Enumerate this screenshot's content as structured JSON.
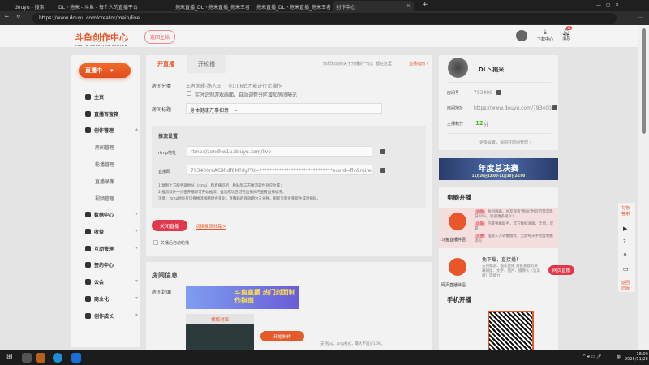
{
  "browser": {
    "tabs": [
      "douyu - 搜索",
      "DL丶拖米 - 斗鱼 - 每个人的直播平台",
      "拖米直播_DL丶拖米直播_拖米王者",
      "拖米直播_DL丶拖米直播_拖米王者",
      "创作中心"
    ],
    "url": "https://www.douyu.com/creator/main/live"
  },
  "header": {
    "logo": "斗鱼创作中心",
    "logo_sub": "DOUYU CREATION CENTER",
    "back_label": "返回主站",
    "download": "下载中心",
    "messages": "消息",
    "msg_badge": "11"
  },
  "sidebar": {
    "live_button": "直播中",
    "items": [
      {
        "label": "主页"
      },
      {
        "label": "直播百宝箱"
      },
      {
        "label": "创作管理"
      },
      {
        "label": "房间管理",
        "sub": true
      },
      {
        "label": "轮播管理",
        "sub": true
      },
      {
        "label": "直播录像",
        "sub": true
      },
      {
        "label": "视频管理",
        "sub": true
      },
      {
        "label": "数据中心"
      },
      {
        "label": "收益"
      },
      {
        "label": "互动管理"
      },
      {
        "label": "签约中心"
      },
      {
        "label": "公会"
      },
      {
        "label": "商业化"
      },
      {
        "label": "创作成长"
      }
    ]
  },
  "live": {
    "tab_live": "开直播",
    "tab_loop": "开轮播",
    "hint": "你想知道的关于开播的一切，都在这里",
    "guide": "直播指南 ›",
    "category_label": "房间分类",
    "category_value": "王者荣耀-路人王",
    "category_note": "01:06后才能进行此操作",
    "auto_detect": "实时识别游戏画面，自动调整分区增加房间曝光",
    "title_label": "房间标题",
    "title_value": "身体健康万事如意！~",
    "push_title": "推流设置",
    "rtmp_label": "rtmp地址",
    "rtmp_value": "rtmp://sendhw1a.douyu.com/live",
    "key_label": "直播码",
    "key_value": "793400reAC9hdf8M?dyPRI=******************************ecord=flv&roirecog",
    "notes": [
      "1.复制上方服务器地址（rtmp）和直播码后，粘贴到三方推流软件对应位置；",
      "2.推流软件中点击开播即可开始推流，推流成功后可在直播间内查看直播情况；",
      "注意：rtmp地址在切换推流线路时会变化，直播码的有效期为五分钟，刷新页面会重新生成直播码。"
    ],
    "close_button": "关闭直播",
    "switch_line": "切换推流线路>",
    "auto_loop": "关播后自动轮播"
  },
  "room": {
    "title": "房间信息",
    "cover_label": "房间封面",
    "cover_banner": "斗鱼直播 热门封面制作指南",
    "landscape": "横版封面",
    "make_button": "开始制作",
    "cover_hint": "支持jpg、png格式，最大不超过10M。"
  },
  "profile": {
    "name": "DL丶拖米",
    "room_no_label": "房间号",
    "room_no": "793400",
    "addr_label": "房间地址",
    "addr": "https://www.douyu.com/793400",
    "score_label": "主播积分",
    "score": "12",
    "score_unit": "分",
    "more": "更多设置，请前往房间管理 ›"
  },
  "banner": {
    "title": "年度总决赛",
    "date": "11月26日12:00-11月30日24:00"
  },
  "pc": {
    "title": "电脑开播",
    "app1": "斗鱼直播伴侣",
    "features": [
      {
        "tag": "流畅",
        "text": "独创线路，水友观看\"原画\"时延迟需求降低20%，吸引更多观众！"
      },
      {
        "tag": "可靠",
        "text": "内置弹幕助手，官方数据准确，全面，可靠！"
      },
      {
        "tag": "方便",
        "text": "摆脱三方转推模式，无需每天手动复制推流码"
      }
    ],
    "app2": "网页直播伴侣",
    "web_title": "免下载，直接播！",
    "web_desc": "支持端游、娱乐直播 具备基础的屏幕捕捉、文字、图片、摄像头（含美颜）等能力",
    "web_button": "网页直播",
    "mobile_title": "手机开播"
  },
  "floating": {
    "gift": "礼物答谢",
    "back_old": "返回旧版"
  },
  "taskbar": {
    "time": "18:00",
    "date": "2025/11/28",
    "ime": "英"
  }
}
